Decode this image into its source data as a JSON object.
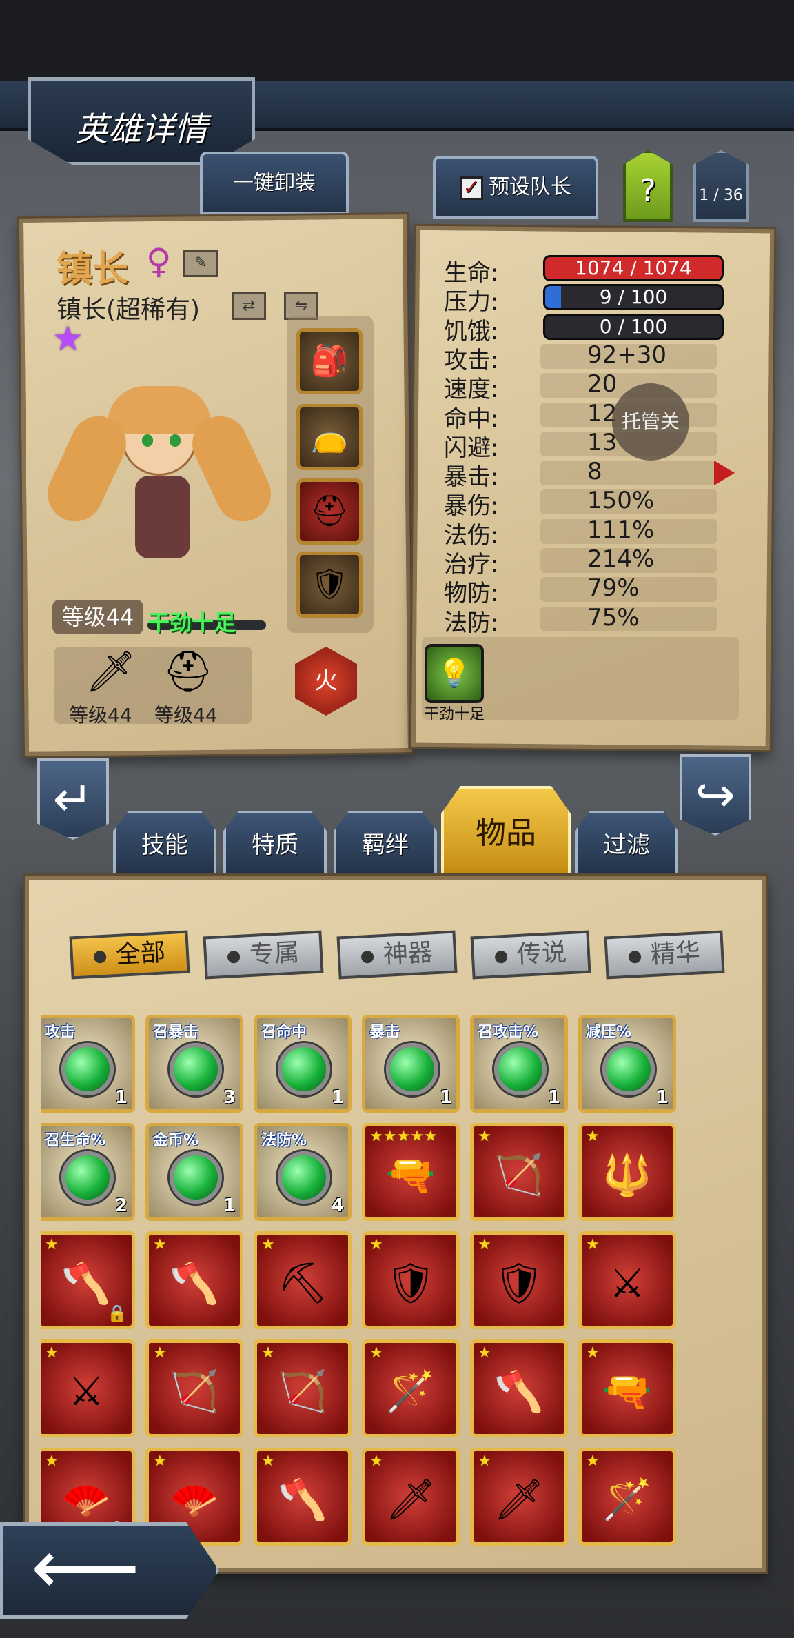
{
  "header": {
    "title": "英雄详情",
    "unequip_all": "一键卸装",
    "preset_leader": "预设队长",
    "preset_checked": "✓",
    "help": "?",
    "page": "1 / 36"
  },
  "hero": {
    "name": "镇长",
    "gender_icon": "female-icon",
    "title": "镇长(超稀有)",
    "level": "等级44",
    "mood": "干劲十足",
    "element": "火",
    "weapon_level": "等级44",
    "armor_level": "等级44"
  },
  "stats": [
    {
      "label": "生命:",
      "value": "1074 / 1074",
      "bar": true,
      "fill": 1.0,
      "color": "#d12a2a"
    },
    {
      "label": "压力:",
      "value": "9 / 100",
      "bar": true,
      "fill": 0.09,
      "color": "#2f6ed6"
    },
    {
      "label": "饥饿:",
      "value": "0 / 100",
      "bar": true,
      "fill": 0.0,
      "color": "#2f6ed6"
    },
    {
      "label": "攻击:",
      "value": "92+30"
    },
    {
      "label": "速度:",
      "value": "20"
    },
    {
      "label": "命中:",
      "value": "12"
    },
    {
      "label": "闪避:",
      "value": "13"
    },
    {
      "label": "暴击:",
      "value": "8"
    },
    {
      "label": "暴伤:",
      "value": "150%"
    },
    {
      "label": "法伤:",
      "value": "111%"
    },
    {
      "label": "治疗:",
      "value": "214%"
    },
    {
      "label": "物防:",
      "value": "79%"
    },
    {
      "label": "法防:",
      "value": "75%"
    }
  ],
  "auto_label": "托管关",
  "trait_label": "干劲十足",
  "tabs": [
    "技能",
    "特质",
    "羁绊",
    "物品",
    "过滤"
  ],
  "active_tab": 3,
  "filters": [
    "全部",
    "专属",
    "神器",
    "传说",
    "精华"
  ],
  "active_filter": 0,
  "items": [
    {
      "type": "gem",
      "label": "攻击",
      "count": "1"
    },
    {
      "type": "gem",
      "label": "召暴击",
      "count": "3"
    },
    {
      "type": "gem",
      "label": "召命中",
      "count": "1"
    },
    {
      "type": "gem",
      "label": "暴击",
      "count": "1"
    },
    {
      "type": "gem",
      "label": "召攻击%",
      "count": "1"
    },
    {
      "type": "gem",
      "label": "减压%",
      "count": "1"
    },
    {
      "type": "gem",
      "label": "召生命%",
      "count": "2"
    },
    {
      "type": "gem",
      "label": "金币%",
      "count": "1"
    },
    {
      "type": "gem",
      "label": "法防%",
      "count": "4"
    },
    {
      "type": "weapon",
      "stars": "★★★★★",
      "icon": "🔫",
      "name": "rifle-icon"
    },
    {
      "type": "weapon",
      "stars": "★",
      "icon": "🏹",
      "name": "crossbow-icon"
    },
    {
      "type": "weapon",
      "stars": "★",
      "icon": "🔱",
      "name": "fire-staff-icon"
    },
    {
      "type": "weapon",
      "stars": "★",
      "icon": "🪓",
      "name": "axe-icon",
      "locked": true
    },
    {
      "type": "weapon",
      "stars": "★",
      "icon": "🪓",
      "name": "axe-icon"
    },
    {
      "type": "weapon",
      "stars": "★",
      "icon": "⛏",
      "name": "scythe-icon"
    },
    {
      "type": "weapon",
      "stars": "★",
      "icon": "🛡",
      "name": "shield-icon"
    },
    {
      "type": "weapon",
      "stars": "★",
      "icon": "🛡",
      "name": "shield-icon"
    },
    {
      "type": "weapon",
      "stars": "★",
      "icon": "⚔",
      "name": "crossed-blades-icon"
    },
    {
      "type": "weapon",
      "stars": "★",
      "icon": "⚔",
      "name": "crossed-blades-icon"
    },
    {
      "type": "weapon",
      "stars": "★",
      "icon": "🏹",
      "name": "bow-icon"
    },
    {
      "type": "weapon",
      "stars": "★",
      "icon": "🏹",
      "name": "crossbow-icon"
    },
    {
      "type": "weapon",
      "stars": "★",
      "icon": "🪄",
      "name": "wand-icon"
    },
    {
      "type": "weapon",
      "stars": "★",
      "icon": "🪓",
      "name": "battle-axe-icon"
    },
    {
      "type": "weapon",
      "stars": "★",
      "icon": "🔫",
      "name": "rifle-icon"
    },
    {
      "type": "weapon",
      "stars": "★",
      "icon": "🪭",
      "name": "fan-icon",
      "locked": true
    },
    {
      "type": "weapon",
      "stars": "★",
      "icon": "🪭",
      "name": "fan-icon"
    },
    {
      "type": "weapon",
      "stars": "★",
      "icon": "🪓",
      "name": "axe-icon"
    },
    {
      "type": "weapon",
      "stars": "★",
      "icon": "🗡",
      "name": "spear-icon"
    },
    {
      "type": "weapon",
      "stars": "★",
      "icon": "🗡",
      "name": "spear-icon"
    },
    {
      "type": "weapon",
      "stars": "★",
      "icon": "🪄",
      "name": "staff-icon"
    }
  ]
}
